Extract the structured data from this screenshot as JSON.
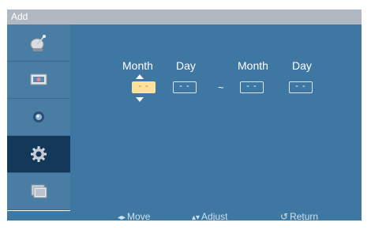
{
  "window": {
    "title": "Add"
  },
  "sidebar": {
    "items": [
      {
        "icon": "satellite-dish-icon",
        "active": false
      },
      {
        "icon": "picture-icon",
        "active": false
      },
      {
        "icon": "sound-icon",
        "active": false
      },
      {
        "icon": "gear-icon",
        "active": true
      },
      {
        "icon": "multi-screen-icon",
        "active": false
      }
    ]
  },
  "date_range": {
    "start": {
      "month_label": "Month",
      "day_label": "Day",
      "month_value": "- -",
      "day_value": "- -"
    },
    "separator": "~",
    "end": {
      "month_label": "Month",
      "day_label": "Day",
      "month_value": "- -",
      "day_value": "- -"
    }
  },
  "footer": {
    "move_label": "Move",
    "adjust_label": "Adjust",
    "return_label": "Return"
  },
  "colors": {
    "accent_selected": "#ffe29a",
    "panel_blue": "#3f77a3",
    "sidebar_active": "#14385a"
  }
}
